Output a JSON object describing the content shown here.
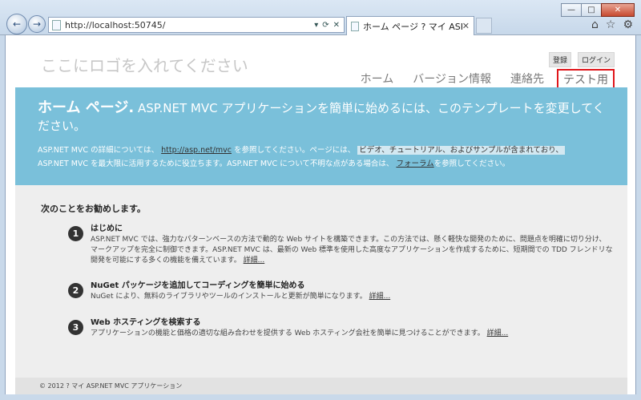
{
  "window": {
    "minimize": "—",
    "maximize": "□",
    "close": "✕"
  },
  "browser": {
    "back_icon": "←",
    "forward_icon": "→",
    "url": "http://localhost:50745/",
    "address_tools": [
      "▾",
      "⟳",
      "✕"
    ],
    "tab_title": "ホーム ページ ? マイ ASP...",
    "tab_close": "✕",
    "home_icon": "⌂",
    "favorites_icon": "☆",
    "tools_icon": "⚙"
  },
  "header": {
    "logo_text": "ここにロゴを入れてください",
    "register": "登録",
    "login": "ログイン",
    "menu": [
      {
        "label": "ホーム"
      },
      {
        "label": "バージョン情報"
      },
      {
        "label": "連絡先"
      },
      {
        "label": "テスト用",
        "active": true
      }
    ]
  },
  "featured": {
    "title_bold": "ホーム ページ.",
    "title_rest": " ASP.NET MVC アプリケーションを簡単に始めるには、このテンプレートを変更してください。",
    "desc_1": "ASP.NET MVC の詳細については、",
    "desc_link": "http://asp.net/mvc",
    "desc_2": " を参照してください。ページには、",
    "desc_highlight": "ビデオ、チュートリアル、およびサンプルが含まれており、",
    "desc_3": "ASP.NET MVC を最大限に活用するために役立ちます。ASP.NET MVC について不明な点がある場合は、",
    "desc_forum": "フォーラム",
    "desc_4": "を参照してください。"
  },
  "main": {
    "suggest_heading": "次のことをお勧めします。",
    "steps": [
      {
        "number": "1",
        "title": "はじめに",
        "text": "ASP.NET MVC では、強力なパターンベースの方法で動的な Web サイトを構築できます。この方法では、懸く軽快な開発のために、問題点を明確に切り分け、マークアップを完全に制御できます。ASP.NET MVC は、最新の Web 標準を使用した高度なアプリケーションを作成するために、短期間での TDD フレンドリな開発を可能にする多くの機能を備えています。",
        "link": "詳細..."
      },
      {
        "number": "2",
        "title": "NuGet パッケージを追加してコーディングを簡単に始める",
        "text": "NuGet により、無料のライブラリやツールのインストールと更新が簡単になります。",
        "link": "詳細..."
      },
      {
        "number": "3",
        "title": "Web ホスティングを検索する",
        "text": "アプリケーションの機能と価格の適切な組み合わせを提供する Web ホスティング会社を簡単に見つけることができます。",
        "link": "詳細..."
      }
    ]
  },
  "footer": {
    "copyright": "© 2012 ? マイ ASP.NET MVC アプリケーション"
  },
  "colors": {
    "featured_bg": "#7ac0da",
    "active_border": "#e0161b",
    "body_bg": "#eeeeee"
  }
}
